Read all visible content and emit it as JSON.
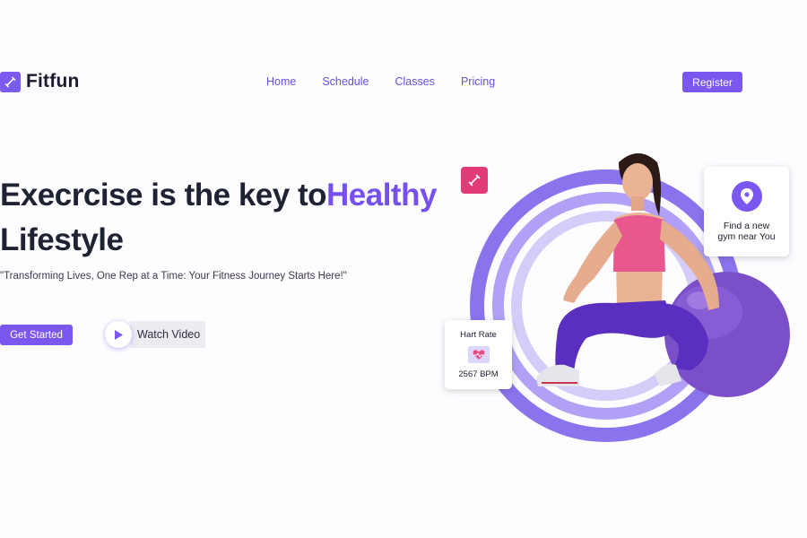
{
  "brand": {
    "name": "Fitfun",
    "logo_icon": "dumbbell-icon"
  },
  "nav": {
    "items": [
      {
        "label": "Home"
      },
      {
        "label": "Schedule"
      },
      {
        "label": "Classes"
      },
      {
        "label": "Pricing"
      }
    ],
    "register_label": "Register"
  },
  "hero": {
    "title_part1": "Execrcise is the key to",
    "title_accent": "Healthy",
    "title_part2": "Lifestyle",
    "subtitle": "\"Transforming Lives, One Rep at a Time: Your Fitness Journey Starts Here!\"",
    "get_started_label": "Get Started",
    "watch_video_label": "Watch Video"
  },
  "cards": {
    "gym": {
      "text_line1": "Find a new",
      "text_line2": "gym near You",
      "icon": "location-pin-icon"
    },
    "heart_rate": {
      "title": "Hart Rate",
      "value": "2567 BPM",
      "icon": "heart-monitor-icon"
    }
  },
  "colors": {
    "accent": "#7a58ef",
    "accent_dark": "#6a4fe0",
    "tag_pink": "#e23b78",
    "ring_outer": "#8c73ee",
    "ring_mid": "#b1a0f5",
    "ring_inner": "#d6ccfa"
  }
}
